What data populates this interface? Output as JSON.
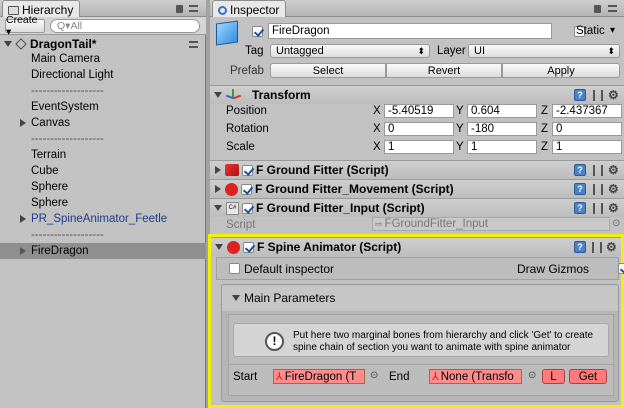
{
  "hierarchy": {
    "tab_label": "Hierarchy",
    "create_label": "Create ▾",
    "search_placeholder": "Q▾All",
    "scene_name": "DragonTail*",
    "items": [
      {
        "label": "Main Camera"
      },
      {
        "label": "Directional Light"
      },
      {
        "label": "-------------------"
      },
      {
        "label": "EventSystem"
      },
      {
        "label": "Canvas"
      },
      {
        "label": "-------------------"
      },
      {
        "label": "Terrain"
      },
      {
        "label": "Cube"
      },
      {
        "label": "Sphere"
      },
      {
        "label": "Sphere"
      },
      {
        "label": "PR_SpineAnimator_Feetle"
      },
      {
        "label": "-------------------"
      },
      {
        "label": "FireDragon"
      }
    ],
    "prefab_color": "#1d3d8c",
    "selected_bg": "#8f8f8f"
  },
  "inspector": {
    "tab_label": "Inspector",
    "object_name": "FireDragon",
    "static_label": "Static",
    "tag_label": "Tag",
    "tag_value": "Untagged",
    "layer_label": "Layer",
    "layer_value": "UI",
    "prefab_label": "Prefab",
    "select_label": "Select",
    "revert_label": "Revert",
    "apply_label": "Apply",
    "transform": {
      "title": "Transform",
      "position_label": "Position",
      "rotation_label": "Rotation",
      "scale_label": "Scale",
      "x": "X",
      "y": "Y",
      "z": "Z",
      "position": [
        "-5.40519",
        "0.604",
        "-2.437367"
      ],
      "rotation": [
        "0",
        "-180",
        "0"
      ],
      "scale": [
        "1",
        "1",
        "1"
      ]
    },
    "components": {
      "ground_fitter": "F Ground Fitter (Script)",
      "ground_fitter_movement": "F Ground Fitter_Movement (Script)",
      "ground_fitter_input": "F Ground Fitter_Input (Script)",
      "script_label": "Script",
      "script_value": "FGroundFitter_Input"
    },
    "spine": {
      "title": "F Spine Animator (Script)",
      "default_inspector": "Default inspector",
      "draw_gizmos": "Draw Gizmos",
      "main_parameters": "Main Parameters",
      "help_text_1": "Put here two marginal bones from hierarchy and click 'Get' to create",
      "help_text_2": "spine chain of section you want to animate with spine animator",
      "help_icon": "!",
      "start_label": "Start",
      "start_value": "FireDragon (T",
      "end_label": "End",
      "end_value": "None (Transfo",
      "l_label": "L",
      "get_label": "Get"
    },
    "highlight_color": "#f2f200"
  }
}
